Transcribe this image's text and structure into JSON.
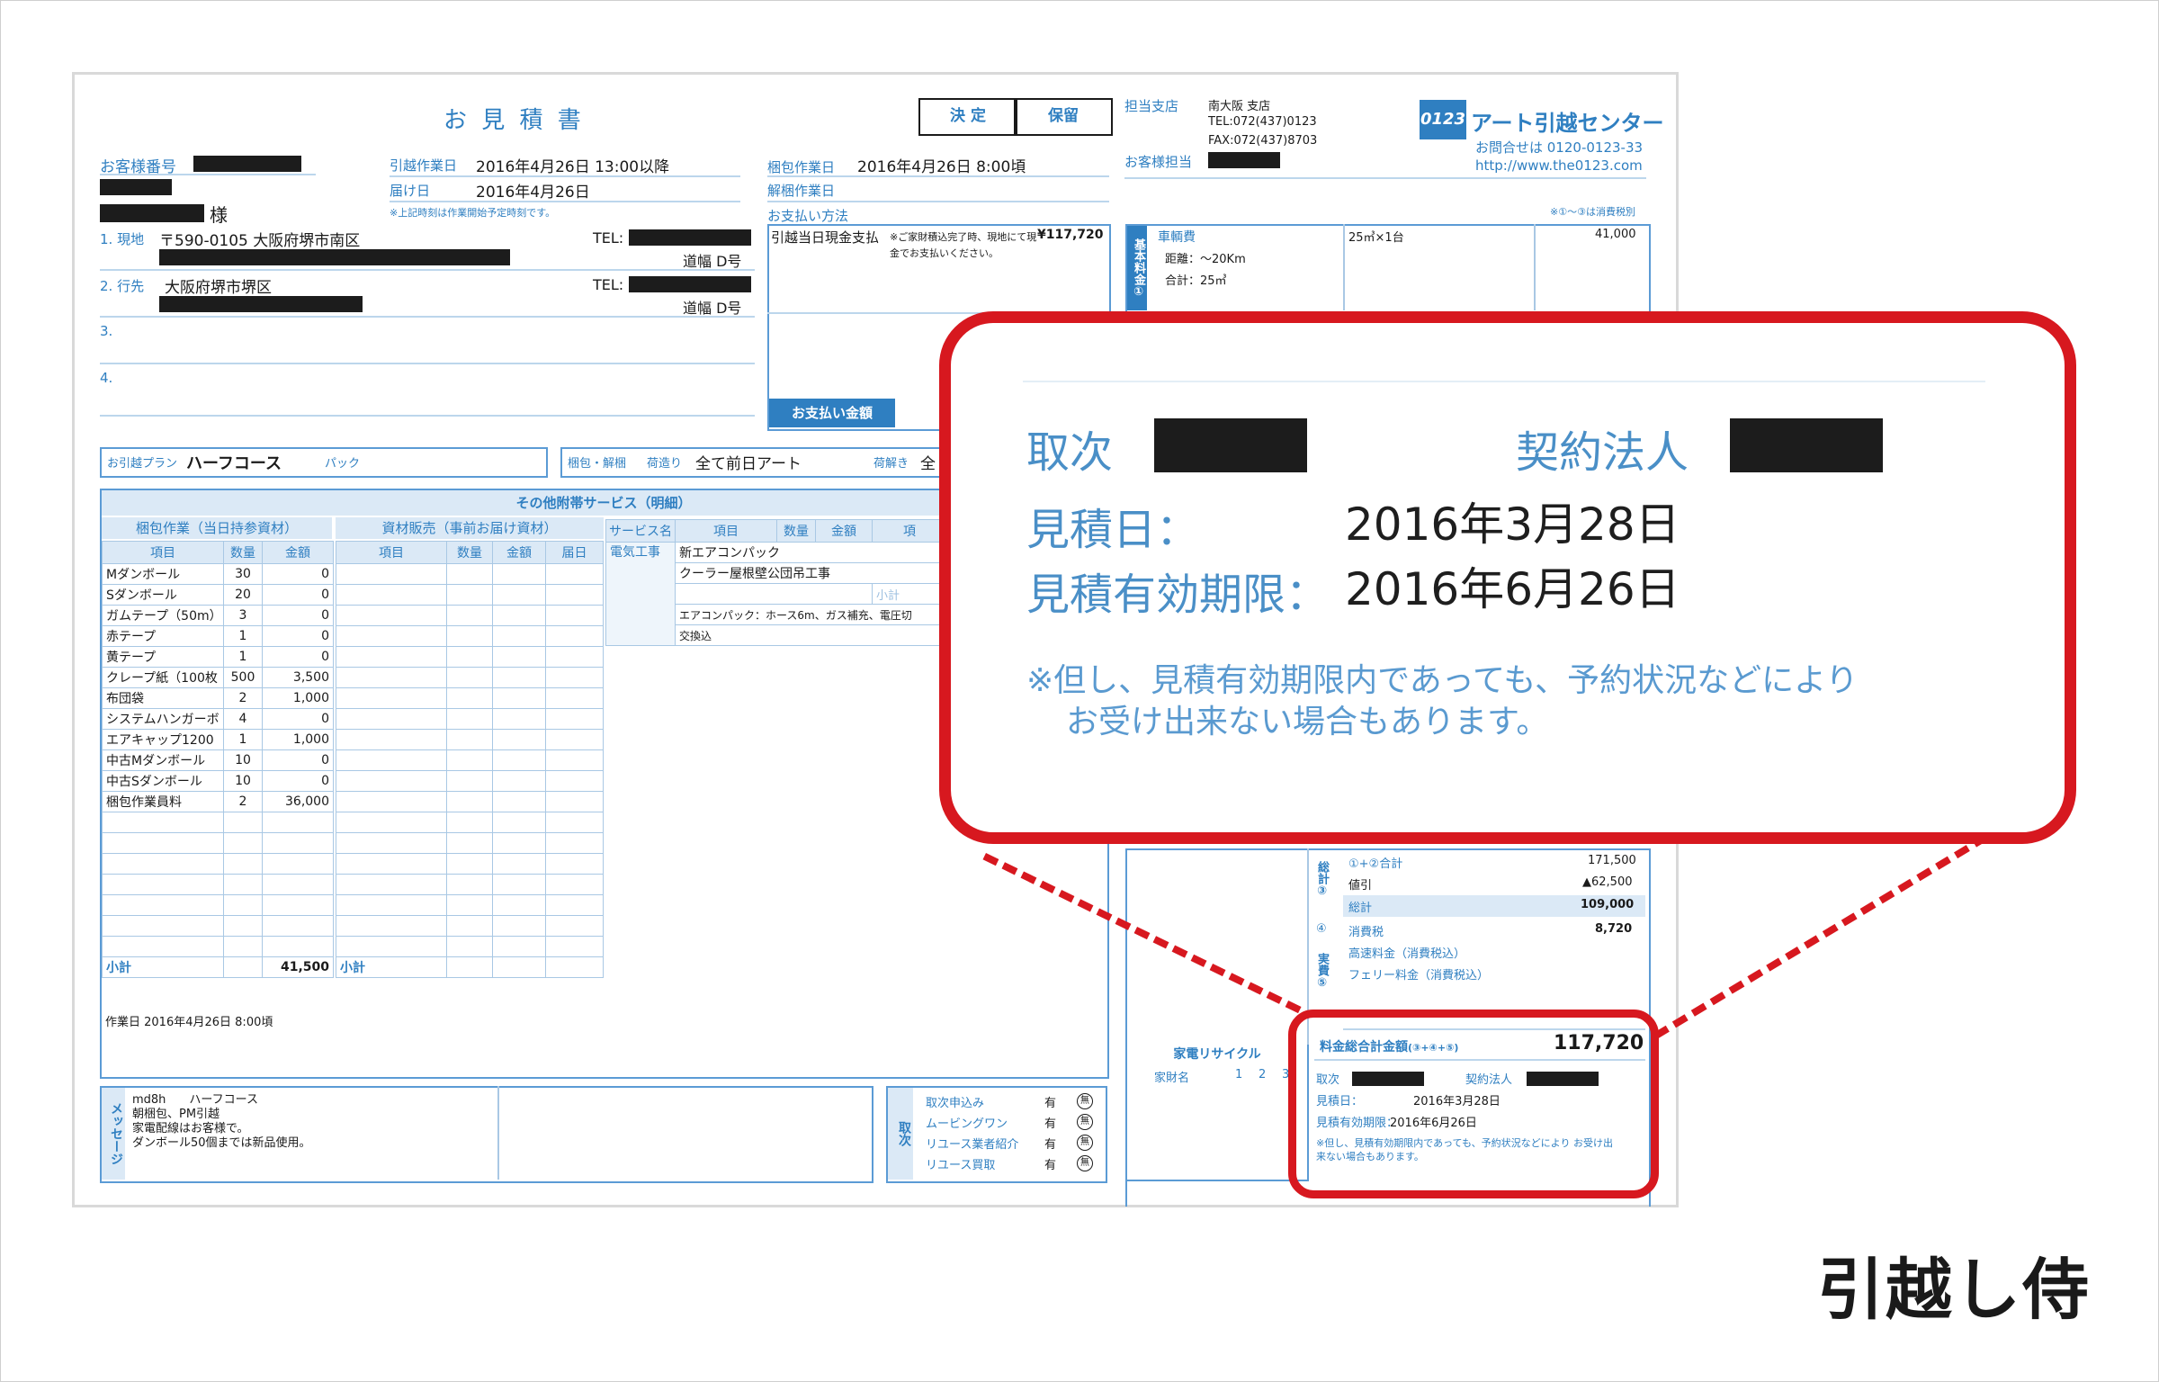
{
  "doc": {
    "title": "お 見 積 書",
    "stamp_decide": "決 定",
    "stamp_hold": "保留",
    "branch_label": "担当支店",
    "branch_name": "南大阪 支店",
    "branch_tel": "TEL:072(437)0123",
    "branch_fax": "FAX:072(437)8703",
    "staff_label": "お客様担当",
    "logo_mark": "0123",
    "company": "アート引越センター",
    "inquiry": "お問合せは 0120-0123-33",
    "url": "http://www.the0123.com",
    "tax_note": "※①〜③は消費税別",
    "customer_no_label": "お客様番号",
    "honorific": "様",
    "move_date_label": "引越作業日",
    "move_date": "2016年4月26日 13:00以降",
    "delivery_label": "届け日",
    "delivery_date": "2016年4月26日",
    "time_note": "※上記時刻は作業開始予定時刻です。",
    "pack_date_label": "梱包作業日",
    "pack_date": "2016年4月26日 8:00頃",
    "unpack_label": "解梱作業日",
    "pay_method_label": "お支払い方法",
    "pay_method": "引越当日現金支払",
    "pay_note": "※ご家財積込完了時、現地にて現金でお支払いください。",
    "pay_amount": "¥117,720",
    "pay_total_label": "お支払い金額",
    "addr1_label": "1. 現地",
    "addr1": "〒590-0105 大阪府堺市南区",
    "addr2_label": "2. 行先",
    "addr2": "大阪府堺市堺区",
    "addr3_label": "3.",
    "addr4_label": "4.",
    "tel_label": "TEL:",
    "road_width": "道幅 D号",
    "plan_label": "お引越プラン",
    "plan": "ハーフコース",
    "pack_label": "パック",
    "pack_unpack_label": "梱包・解梱",
    "pack_type_label": "荷造り",
    "pack_type": "全て前日アート",
    "unpack_type_label": "荷解き",
    "unpack_type": "全",
    "basic_fee_side": "基本料金①",
    "vehicle_fee_label": "車輌費",
    "distance": "距離：〜20Km",
    "total_volume": "合計：25㎥",
    "vehicle_spec": "25㎥×1台",
    "vehicle_amount": "41,000",
    "services_title": "その他附帯サービス（明細）",
    "pack_work_title": "梱包作業（当日持参資材）",
    "material_sale_title": "資材販売（事前お届け資材）",
    "col_item": "項目",
    "col_qty": "数量",
    "col_amount": "金額",
    "col_delivery": "届日",
    "col_service": "サービス名",
    "col_remark": "項",
    "pack_items": [
      {
        "name": "Mダンボール",
        "qty": "30",
        "amount": "0"
      },
      {
        "name": "Sダンボール",
        "qty": "20",
        "amount": "0"
      },
      {
        "name": "ガムテープ（50m）",
        "qty": "3",
        "amount": "0"
      },
      {
        "name": "赤テープ",
        "qty": "1",
        "amount": "0"
      },
      {
        "name": "黄テープ",
        "qty": "1",
        "amount": "0"
      },
      {
        "name": "クレープ紙（100枚",
        "qty": "500",
        "amount": "3,500"
      },
      {
        "name": "布団袋",
        "qty": "2",
        "amount": "1,000"
      },
      {
        "name": "システムハンガーボ",
        "qty": "4",
        "amount": "0"
      },
      {
        "name": "エアキャップ1200",
        "qty": "1",
        "amount": "1,000"
      },
      {
        "name": "中古Mダンボール",
        "qty": "10",
        "amount": "0"
      },
      {
        "name": "中古Sダンボール",
        "qty": "10",
        "amount": "0"
      },
      {
        "name": "梱包作業員料",
        "qty": "2",
        "amount": "36,000"
      }
    ],
    "subtotal_label": "小計",
    "pack_subtotal": "41,500",
    "pack_work_date": "作業日 2016年4月26日 8:00頃",
    "service_category": "電気工事",
    "service_item1": "新エアコンパック",
    "service_item2": "クーラー屋根壁公団吊工事",
    "service_subtotal": "小計",
    "service_desc": "エアコンパック：ホース6m、ガス補充、電圧切",
    "service_desc2": "交換込",
    "sum12_label": "①+②合計",
    "sum12": "171,500",
    "total_side": "総計③",
    "discount_label": "値引",
    "discount": "▲62,500",
    "total_label": "総計",
    "total": "109,000",
    "tax_num": "④",
    "tax_label": "消費税",
    "tax": "8,720",
    "actual_side": "実費⑤",
    "highway_label": "高速料金（消費税込）",
    "ferry_label": "フェリー料金（消費税込）",
    "appliance_title": "家電リサイクル",
    "appliance_name_label": "家財名",
    "appliance_cols": [
      "1",
      "2",
      "3"
    ],
    "grand_total_label": "料金総合計金額",
    "grand_total_formula": "(③+④+⑤)",
    "grand_total": "117,720",
    "small_agent": "取次",
    "small_contract": "契約法人",
    "small_est_date_label": "見積日：",
    "small_est_date": "2016年3月28日",
    "small_valid_label": "見積有効期限：",
    "small_valid": "2016年6月26日",
    "small_note": "※但し、見積有効期限内であっても、予約状況などにより お受け出来ない場合もあります。",
    "message_label": "メッセージ",
    "message_lines": [
      "md8h　　ハーフコース",
      "朝梱包、PM引越",
      "家電配線はお客様で。",
      "ダンボール50個までは新品使用。"
    ],
    "referral_label": "取次",
    "referral_items": [
      {
        "name": "取次申込み",
        "value": "有"
      },
      {
        "name": "ムービングワン",
        "value": "有"
      },
      {
        "name": "リユース業者紹介",
        "value": "有"
      },
      {
        "name": "リユース買取",
        "value": "有"
      }
    ],
    "referral_mark": "無"
  },
  "callout": {
    "agent_label": "取次",
    "contract_label": "契約法人",
    "est_date_label": "見積日：",
    "est_date": "2016年3月28日",
    "valid_label": "見積有効期限：",
    "valid_date": "2016年6月26日",
    "note_line1": "※但し、見積有効期限内であっても、予約状況などにより",
    "note_line2": "お受け出来ない場合もあります。"
  },
  "brand": "引越し侍",
  "colors": {
    "accent_red": "#d7181f",
    "doc_blue": "#2f7fc1"
  }
}
